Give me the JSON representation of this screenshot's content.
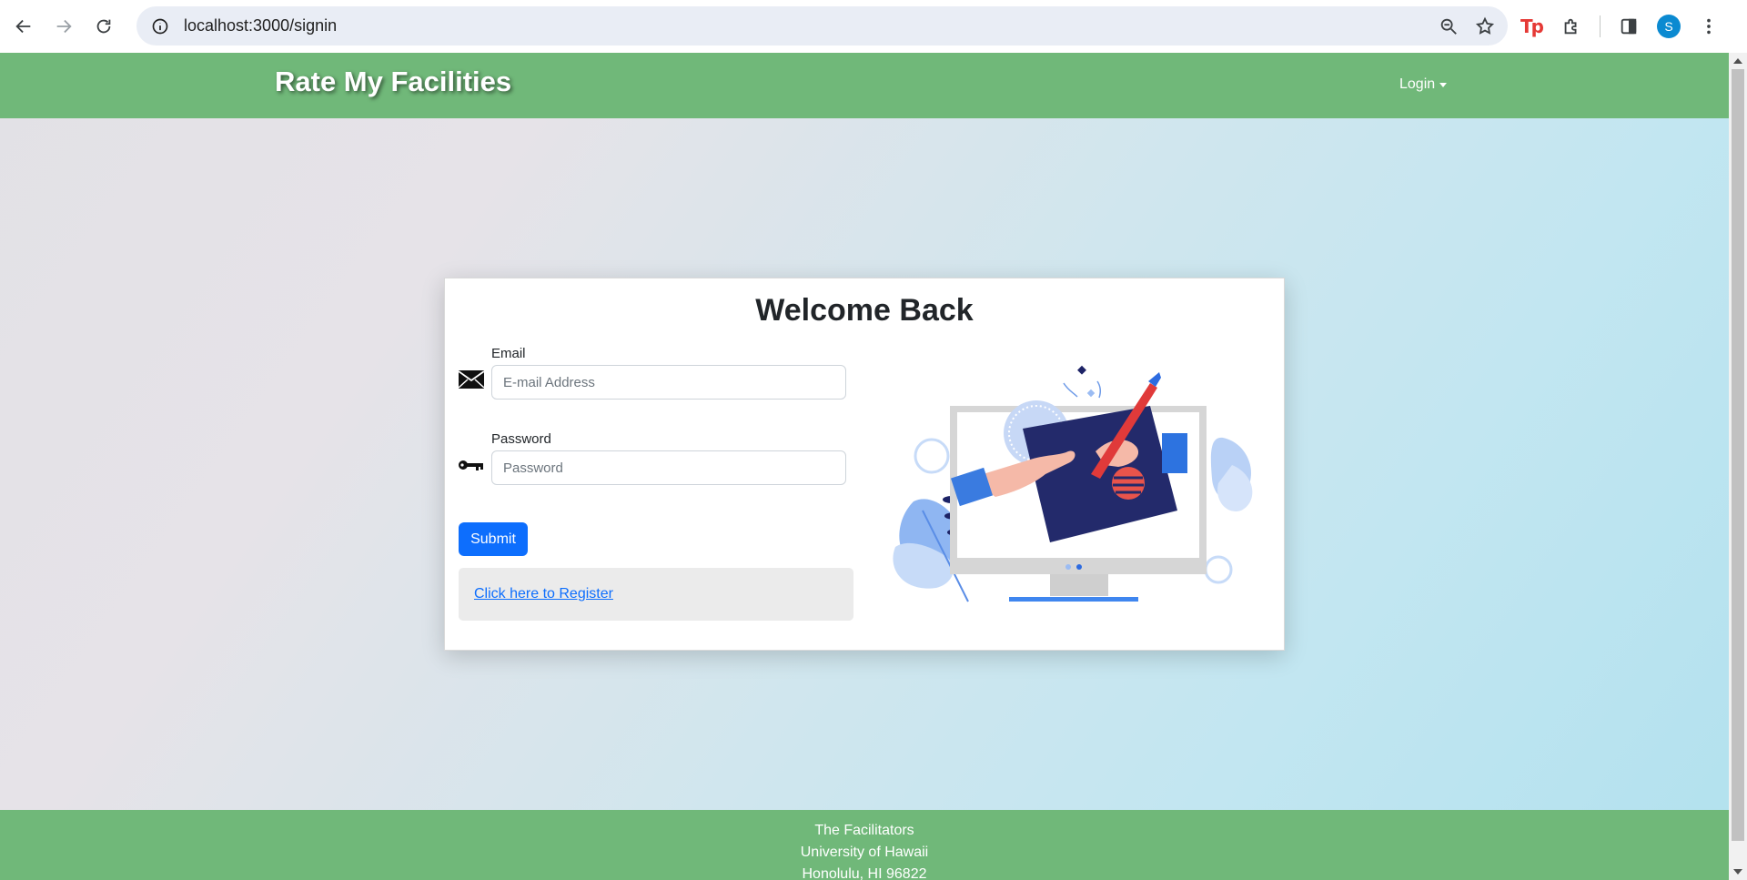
{
  "browser": {
    "url": "localhost:3000/signin",
    "profile_initial": "S",
    "extension_label": "Tp"
  },
  "site": {
    "brand": "Rate My Facilities",
    "login_menu": "Login"
  },
  "signin": {
    "title": "Welcome Back",
    "email_label": "Email",
    "email_placeholder": "E-mail Address",
    "password_label": "Password",
    "password_placeholder": "Password",
    "submit_label": "Submit",
    "register_link": "Click here to Register"
  },
  "footer": {
    "line1": "The Facilitators",
    "line2": "University of Hawaii",
    "line3": "Honolulu, HI 96822"
  },
  "colors": {
    "nav_green": "#70b879",
    "primary_blue": "#0d6efd"
  }
}
